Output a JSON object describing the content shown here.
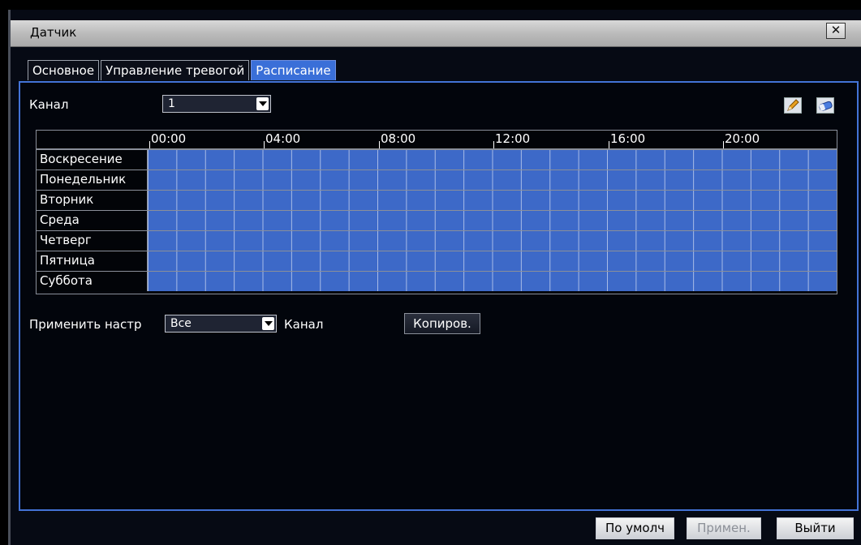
{
  "window": {
    "title": "Датчик"
  },
  "tabs": [
    {
      "label": "Основное",
      "active": false
    },
    {
      "label": "Управление тревогой",
      "active": false
    },
    {
      "label": "Расписание",
      "active": true
    }
  ],
  "channel": {
    "label": "Канал",
    "value": "1"
  },
  "tools": [
    "pencil-icon",
    "eraser-icon"
  ],
  "schedule": {
    "time_labels": [
      "00:00",
      "04:00",
      "08:00",
      "12:00",
      "16:00",
      "20:00"
    ],
    "days": [
      "Воскресение",
      "Понедельник",
      "Вторник",
      "Среда",
      "Четверг",
      "Пятница",
      "Суббота"
    ],
    "fill_color": "#3d69c8",
    "selected_fraction": 1.0
  },
  "apply": {
    "label": "Применить настр",
    "value": "Все",
    "channel_label": "Канал",
    "copy_label": "Копиров."
  },
  "footer": {
    "default_label": "По умолч",
    "apply_label": "Примен.",
    "exit_label": "Выйти"
  },
  "colors": {
    "accent": "#3a6fd8",
    "panel_border": "#4373d6"
  }
}
